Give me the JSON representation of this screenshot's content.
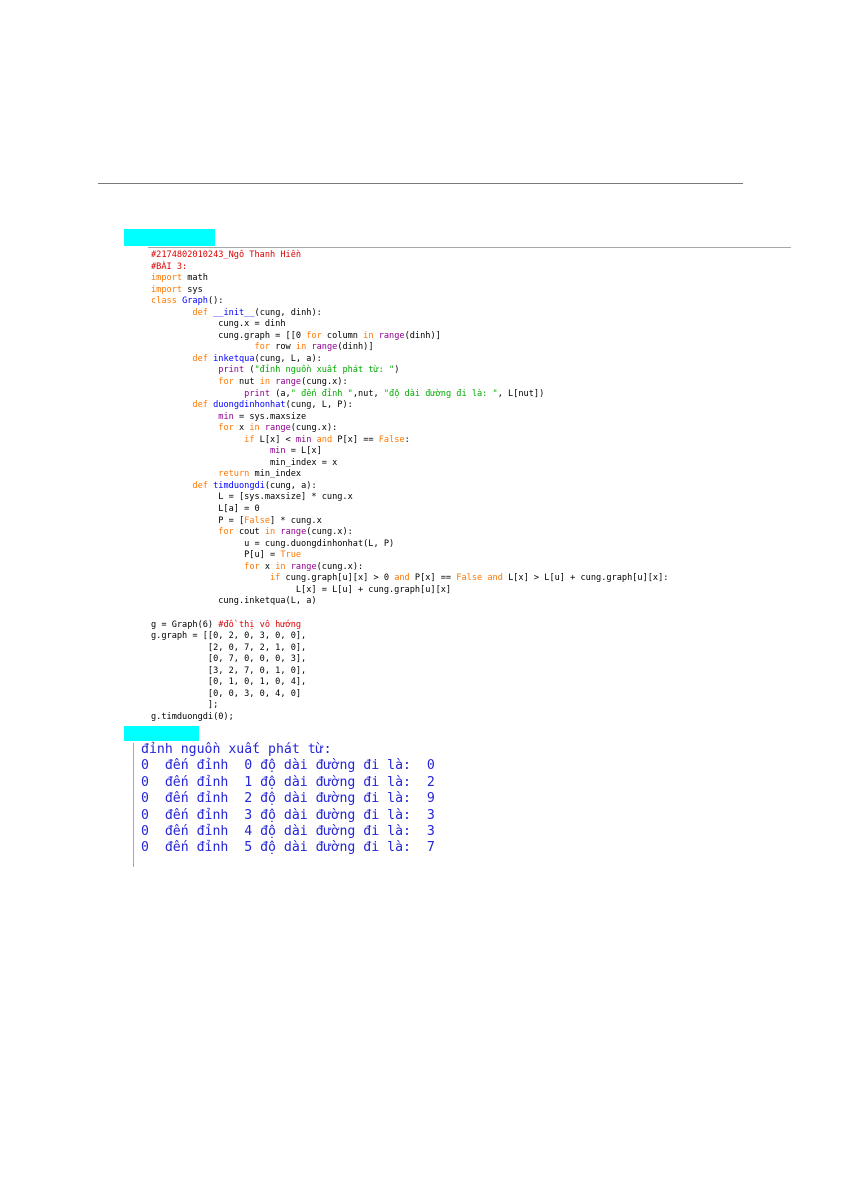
{
  "colors": {
    "comment": "#dd0000",
    "keyword": "#ff7700",
    "builtin": "#900090",
    "definition": "#0000ff",
    "string": "#00aa00",
    "default": "#000000",
    "output_text": "#2424d8",
    "label_highlight": "#00ffff"
  },
  "code_lines": [
    [
      {
        "t": "#2174802010243_Ngô Thanh Hiền",
        "c": "comment"
      }
    ],
    [
      {
        "t": "#BÀI 3:",
        "c": "comment"
      }
    ],
    [
      {
        "t": "import",
        "c": "keyword"
      },
      {
        "t": " math",
        "c": "default"
      }
    ],
    [
      {
        "t": "import",
        "c": "keyword"
      },
      {
        "t": " sys",
        "c": "default"
      }
    ],
    [
      {
        "t": "class",
        "c": "keyword"
      },
      {
        "t": " ",
        "c": "default"
      },
      {
        "t": "Graph",
        "c": "definition"
      },
      {
        "t": "():",
        "c": "default"
      }
    ],
    [
      {
        "t": "        ",
        "c": "default"
      },
      {
        "t": "def",
        "c": "keyword"
      },
      {
        "t": " ",
        "c": "default"
      },
      {
        "t": "__init__",
        "c": "definition"
      },
      {
        "t": "(cung, dinh):",
        "c": "default"
      }
    ],
    [
      {
        "t": "             cung.x = dinh",
        "c": "default"
      }
    ],
    [
      {
        "t": "             cung.graph = [[0 ",
        "c": "default"
      },
      {
        "t": "for",
        "c": "keyword"
      },
      {
        "t": " column ",
        "c": "default"
      },
      {
        "t": "in",
        "c": "keyword"
      },
      {
        "t": " ",
        "c": "default"
      },
      {
        "t": "range",
        "c": "builtin"
      },
      {
        "t": "(dinh)]",
        "c": "default"
      }
    ],
    [
      {
        "t": "                    ",
        "c": "default"
      },
      {
        "t": "for",
        "c": "keyword"
      },
      {
        "t": " row ",
        "c": "default"
      },
      {
        "t": "in",
        "c": "keyword"
      },
      {
        "t": " ",
        "c": "default"
      },
      {
        "t": "range",
        "c": "builtin"
      },
      {
        "t": "(dinh)]",
        "c": "default"
      }
    ],
    [
      {
        "t": "        ",
        "c": "default"
      },
      {
        "t": "def",
        "c": "keyword"
      },
      {
        "t": " ",
        "c": "default"
      },
      {
        "t": "inketqua",
        "c": "definition"
      },
      {
        "t": "(cung, L, a):",
        "c": "default"
      }
    ],
    [
      {
        "t": "             ",
        "c": "default"
      },
      {
        "t": "print",
        "c": "builtin"
      },
      {
        "t": " (",
        "c": "default"
      },
      {
        "t": "\"đỉnh nguồn xuất phát từ: \"",
        "c": "string"
      },
      {
        "t": ")",
        "c": "default"
      }
    ],
    [
      {
        "t": "             ",
        "c": "default"
      },
      {
        "t": "for",
        "c": "keyword"
      },
      {
        "t": " nut ",
        "c": "default"
      },
      {
        "t": "in",
        "c": "keyword"
      },
      {
        "t": " ",
        "c": "default"
      },
      {
        "t": "range",
        "c": "builtin"
      },
      {
        "t": "(cung.x):",
        "c": "default"
      }
    ],
    [
      {
        "t": "                  ",
        "c": "default"
      },
      {
        "t": "print",
        "c": "builtin"
      },
      {
        "t": " (a,",
        "c": "default"
      },
      {
        "t": "\" đến đỉnh \"",
        "c": "string"
      },
      {
        "t": ",nut, ",
        "c": "default"
      },
      {
        "t": "\"độ dài đường đi là: \"",
        "c": "string"
      },
      {
        "t": ", L[nut])",
        "c": "default"
      }
    ],
    [
      {
        "t": "        ",
        "c": "default"
      },
      {
        "t": "def",
        "c": "keyword"
      },
      {
        "t": " ",
        "c": "default"
      },
      {
        "t": "duongdinhonhat",
        "c": "definition"
      },
      {
        "t": "(cung, L, P):",
        "c": "default"
      }
    ],
    [
      {
        "t": "             ",
        "c": "default"
      },
      {
        "t": "min",
        "c": "builtin"
      },
      {
        "t": " = sys.maxsize",
        "c": "default"
      }
    ],
    [
      {
        "t": "             ",
        "c": "default"
      },
      {
        "t": "for",
        "c": "keyword"
      },
      {
        "t": " x ",
        "c": "default"
      },
      {
        "t": "in",
        "c": "keyword"
      },
      {
        "t": " ",
        "c": "default"
      },
      {
        "t": "range",
        "c": "builtin"
      },
      {
        "t": "(cung.x):",
        "c": "default"
      }
    ],
    [
      {
        "t": "                  ",
        "c": "default"
      },
      {
        "t": "if",
        "c": "keyword"
      },
      {
        "t": " L[x] < ",
        "c": "default"
      },
      {
        "t": "min",
        "c": "builtin"
      },
      {
        "t": " ",
        "c": "default"
      },
      {
        "t": "and",
        "c": "keyword"
      },
      {
        "t": " P[x] == ",
        "c": "default"
      },
      {
        "t": "False",
        "c": "keyword"
      },
      {
        "t": ":",
        "c": "default"
      }
    ],
    [
      {
        "t": "                       ",
        "c": "default"
      },
      {
        "t": "min",
        "c": "builtin"
      },
      {
        "t": " = L[x]",
        "c": "default"
      }
    ],
    [
      {
        "t": "                       min_index = x",
        "c": "default"
      }
    ],
    [
      {
        "t": "             ",
        "c": "default"
      },
      {
        "t": "return",
        "c": "keyword"
      },
      {
        "t": " min_index",
        "c": "default"
      }
    ],
    [
      {
        "t": "        ",
        "c": "default"
      },
      {
        "t": "def",
        "c": "keyword"
      },
      {
        "t": " ",
        "c": "default"
      },
      {
        "t": "timduongdi",
        "c": "definition"
      },
      {
        "t": "(cung, a):",
        "c": "default"
      }
    ],
    [
      {
        "t": "             L = [sys.maxsize] * cung.x",
        "c": "default"
      }
    ],
    [
      {
        "t": "             L[a] = 0",
        "c": "default"
      }
    ],
    [
      {
        "t": "             P = [",
        "c": "default"
      },
      {
        "t": "False",
        "c": "keyword"
      },
      {
        "t": "] * cung.x",
        "c": "default"
      }
    ],
    [
      {
        "t": "             ",
        "c": "default"
      },
      {
        "t": "for",
        "c": "keyword"
      },
      {
        "t": " cout ",
        "c": "default"
      },
      {
        "t": "in",
        "c": "keyword"
      },
      {
        "t": " ",
        "c": "default"
      },
      {
        "t": "range",
        "c": "builtin"
      },
      {
        "t": "(cung.x):",
        "c": "default"
      }
    ],
    [
      {
        "t": "                  u = cung.duongdinhonhat(L, P)",
        "c": "default"
      }
    ],
    [
      {
        "t": "                  P[u] = ",
        "c": "default"
      },
      {
        "t": "True",
        "c": "keyword"
      }
    ],
    [
      {
        "t": "                  ",
        "c": "default"
      },
      {
        "t": "for",
        "c": "keyword"
      },
      {
        "t": " x ",
        "c": "default"
      },
      {
        "t": "in",
        "c": "keyword"
      },
      {
        "t": " ",
        "c": "default"
      },
      {
        "t": "range",
        "c": "builtin"
      },
      {
        "t": "(cung.x):",
        "c": "default"
      }
    ],
    [
      {
        "t": "                       ",
        "c": "default"
      },
      {
        "t": "if",
        "c": "keyword"
      },
      {
        "t": " cung.graph[u][x] > 0 ",
        "c": "default"
      },
      {
        "t": "and",
        "c": "keyword"
      },
      {
        "t": " P[x] == ",
        "c": "default"
      },
      {
        "t": "False",
        "c": "keyword"
      },
      {
        "t": " ",
        "c": "default"
      },
      {
        "t": "and",
        "c": "keyword"
      },
      {
        "t": " L[x] > L[u] + cung.graph[u][x]:",
        "c": "default"
      }
    ],
    [
      {
        "t": "                            L[x] = L[u] + cung.graph[u][x]",
        "c": "default"
      }
    ],
    [
      {
        "t": "             cung.inketqua(L, a)",
        "c": "default"
      }
    ],
    [
      {
        "t": "",
        "c": "default"
      }
    ],
    [
      {
        "t": "g = Graph(6) ",
        "c": "default"
      },
      {
        "t": "#đồ thị vô hướng",
        "c": "comment"
      }
    ],
    [
      {
        "t": "g.graph = [[0, 2, 0, 3, 0, 0],",
        "c": "default"
      }
    ],
    [
      {
        "t": "           [2, 0, 7, 2, 1, 0],",
        "c": "default"
      }
    ],
    [
      {
        "t": "           [0, 7, 0, 0, 0, 3],",
        "c": "default"
      }
    ],
    [
      {
        "t": "           [3, 2, 7, 0, 1, 0],",
        "c": "default"
      }
    ],
    [
      {
        "t": "           [0, 1, 0, 1, 0, 4],",
        "c": "default"
      }
    ],
    [
      {
        "t": "           [0, 0, 3, 0, 4, 0]",
        "c": "default"
      }
    ],
    [
      {
        "t": "           ];",
        "c": "default"
      }
    ],
    [
      {
        "t": "g.timduongdi(0);",
        "c": "default"
      }
    ]
  ],
  "output_lines": [
    "đỉnh nguồn xuất phát từ:",
    "0  đến đỉnh  0 độ dài đường đi là:  0",
    "0  đến đỉnh  1 độ dài đường đi là:  2",
    "0  đến đỉnh  2 độ dài đường đi là:  9",
    "0  đến đỉnh  3 độ dài đường đi là:  3",
    "0  đến đỉnh  4 độ dài đường đi là:  3",
    "0  đến đỉnh  5 độ dài đường đi là:  7"
  ]
}
